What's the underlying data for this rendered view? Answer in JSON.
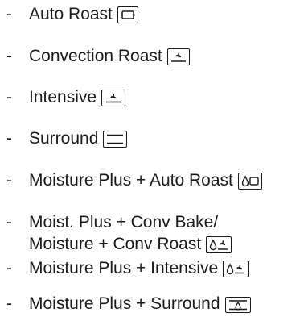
{
  "bullet": "-",
  "items": [
    {
      "id": "auto-roast",
      "lines": [
        "Auto Roast"
      ],
      "icon": "auto-roast-icon"
    },
    {
      "id": "convection-roast",
      "lines": [
        "Convection Roast"
      ],
      "icon": "convection-roast-icon"
    },
    {
      "id": "intensive",
      "lines": [
        "Intensive"
      ],
      "icon": "intensive-icon"
    },
    {
      "id": "surround",
      "lines": [
        "Surround"
      ],
      "icon": "surround-icon"
    },
    {
      "id": "moisture-plus-auto-roast",
      "lines": [
        "Moisture Plus + Auto Roast"
      ],
      "icon": "moisture-auto-roast-icon"
    },
    {
      "id": "moist-plus-conv-bake",
      "lines": [
        "Moist. Plus + Conv Bake/",
        "Moisture + Conv Roast"
      ],
      "icon": "moisture-conv-roast-icon"
    },
    {
      "id": "moisture-plus-intensive",
      "lines": [
        "Moisture Plus + Intensive"
      ],
      "icon": "moisture-intensive-icon"
    },
    {
      "id": "moisture-plus-surround",
      "lines": [
        "Moisture Plus + Surround"
      ],
      "icon": "moisture-surround-icon"
    }
  ]
}
